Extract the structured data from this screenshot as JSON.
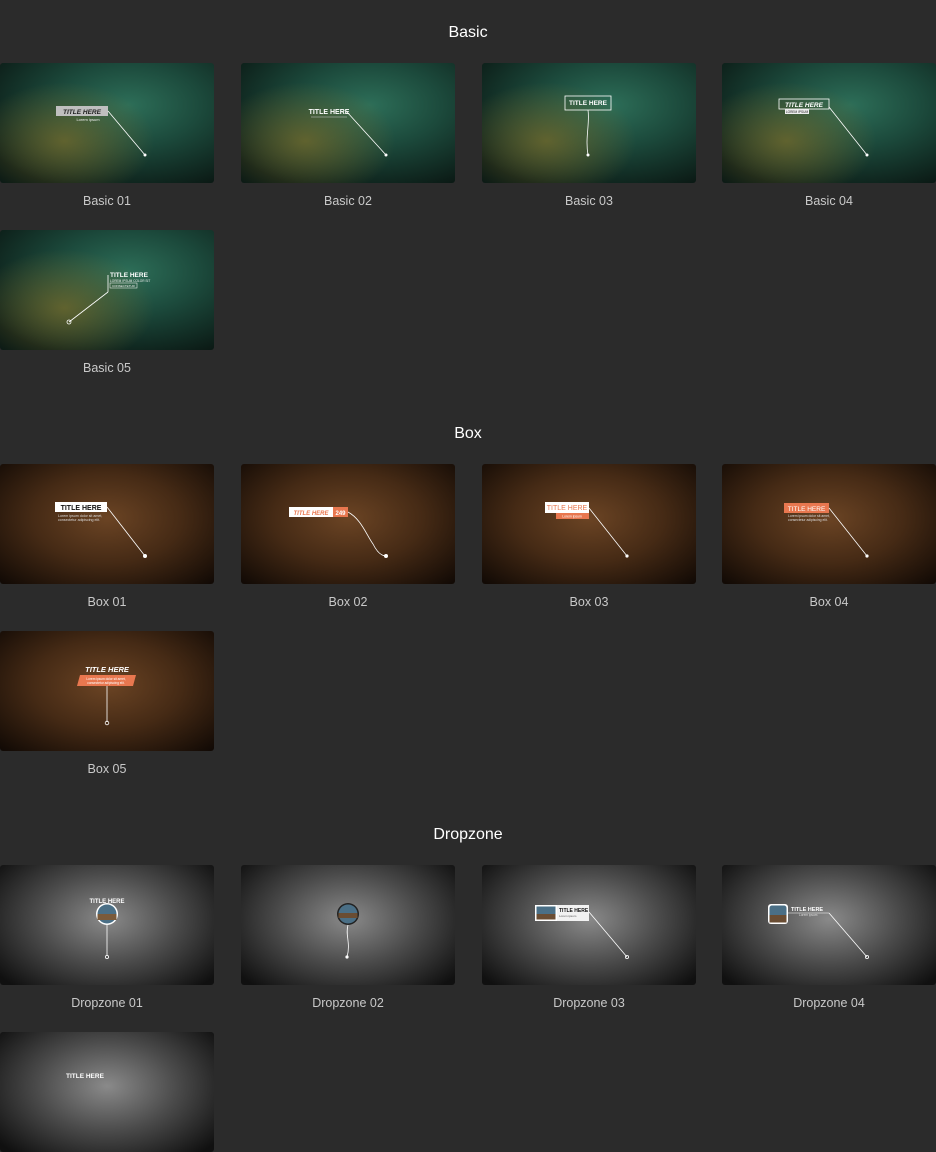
{
  "sections": [
    {
      "title": "Basic"
    },
    {
      "title": "Box"
    },
    {
      "title": "Dropzone"
    }
  ],
  "tiles": {
    "basic": [
      "Basic 01",
      "Basic 02",
      "Basic 03",
      "Basic 04",
      "Basic 05"
    ],
    "box": [
      "Box 01",
      "Box 02",
      "Box 03",
      "Box 04",
      "Box 05"
    ],
    "dropzone": [
      "Dropzone 01",
      "Dropzone 02",
      "Dropzone 03",
      "Dropzone 04"
    ]
  },
  "thumb_text": {
    "title_here": "TITLE HERE",
    "title_here_italic": "TITLE HERE",
    "lorem_ipsum": "Lorem ipsum",
    "lorem_ipsum_caps": "LOREM IPSUM",
    "box02_number": "249",
    "lorem_long": "Lorem ipsum dolor sit amet,",
    "lorem_long2": "consectetur adipiscing elit.",
    "lorem_color": "LOREM IPSUM COLOR SIT",
    "consectetur": "CONSECTETUR"
  },
  "colors": {
    "background": "#2b2b2b",
    "accent_orange": "#e8774f"
  }
}
